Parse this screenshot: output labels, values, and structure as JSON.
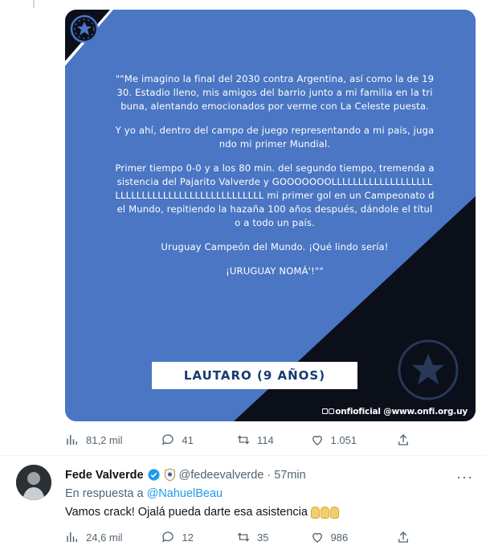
{
  "card": {
    "quote_paragraphs": [
      "\"\"Me imagino la final del 2030 contra Argentina, así como la de 1930. Estadio lleno, mis amigos del barrio junto a mi familia en la tribuna, alentando emocionados por verme con La Celeste puesta.",
      "Y yo ahí, dentro del campo de juego representando a mi país, jugando mi primer Mundial.",
      "Primer tiempo 0-0 y a los 80 min. del segundo tiempo, tremenda asistencia del Pajarito Valverde y GOOOOOOOLLLLLLLLLLLLLLLLLLLLLLLLLLLLLLLLLLLLLLLLLLLLLLL mi primer gol en un Campeonato del Mundo, repitiendo la hazaña 100 años después, dándole el título a todo un país.",
      "Uruguay Campeón del Mundo. ¡Qué lindo sería!",
      "¡URUGUAY NOMÁ'!\"\""
    ],
    "name_box": "LAUTARO (9 AÑOS)",
    "footer": "onfioficial @www.onfi.org.uy",
    "colors": {
      "background": "#4a76c3",
      "dark": "#0b0f1a"
    }
  },
  "tweet_actions": {
    "views": "81,2 mil",
    "replies": "41",
    "retweets": "114",
    "likes": "1.051"
  },
  "reply": {
    "display_name": "Fede Valverde",
    "handle": "@fedeevalverde",
    "dot": "·",
    "time": "57min",
    "reply_prefix": "En respuesta a",
    "reply_to": "@NahuelBeau",
    "text": "Vamos crack! Ojalá pueda darte esa asistencia",
    "more": "···",
    "actions": {
      "views": "24,6 mil",
      "replies": "12",
      "retweets": "35",
      "likes": "986"
    }
  }
}
